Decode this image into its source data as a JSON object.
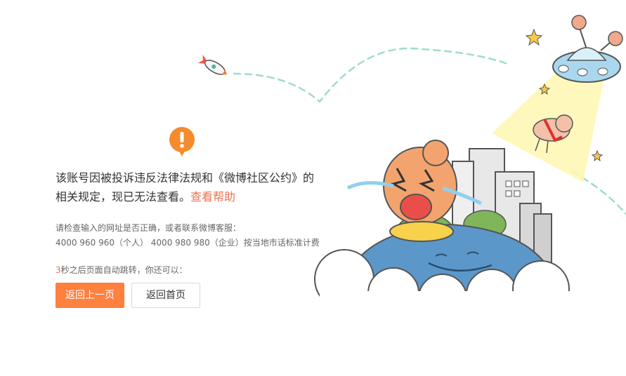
{
  "message": {
    "main_text": "该账号因被投诉违反法律法规和《微博社区公约》的相关规定，现已无法查看。",
    "help_link": "查看帮助"
  },
  "hint": {
    "line1": "请检查输入的网址是否正确，或者联系微博客服：",
    "line2": "4000 960 960（个人） 4000 980 980（企业）按当地市话标准计费"
  },
  "redirect": {
    "seconds": "3",
    "text": "秒之后页面自动跳转，你还可以："
  },
  "buttons": {
    "back_label": "返回上一页",
    "home_label": "返回首页"
  },
  "colors": {
    "accent": "#ff8140",
    "link": "#eb7350",
    "warning_icon": "#f78a2a",
    "dashes": "#9fdccb"
  },
  "icons": {
    "warning": "exclamation-icon",
    "rocket": "rocket-icon",
    "ufo": "ufo-icon"
  }
}
